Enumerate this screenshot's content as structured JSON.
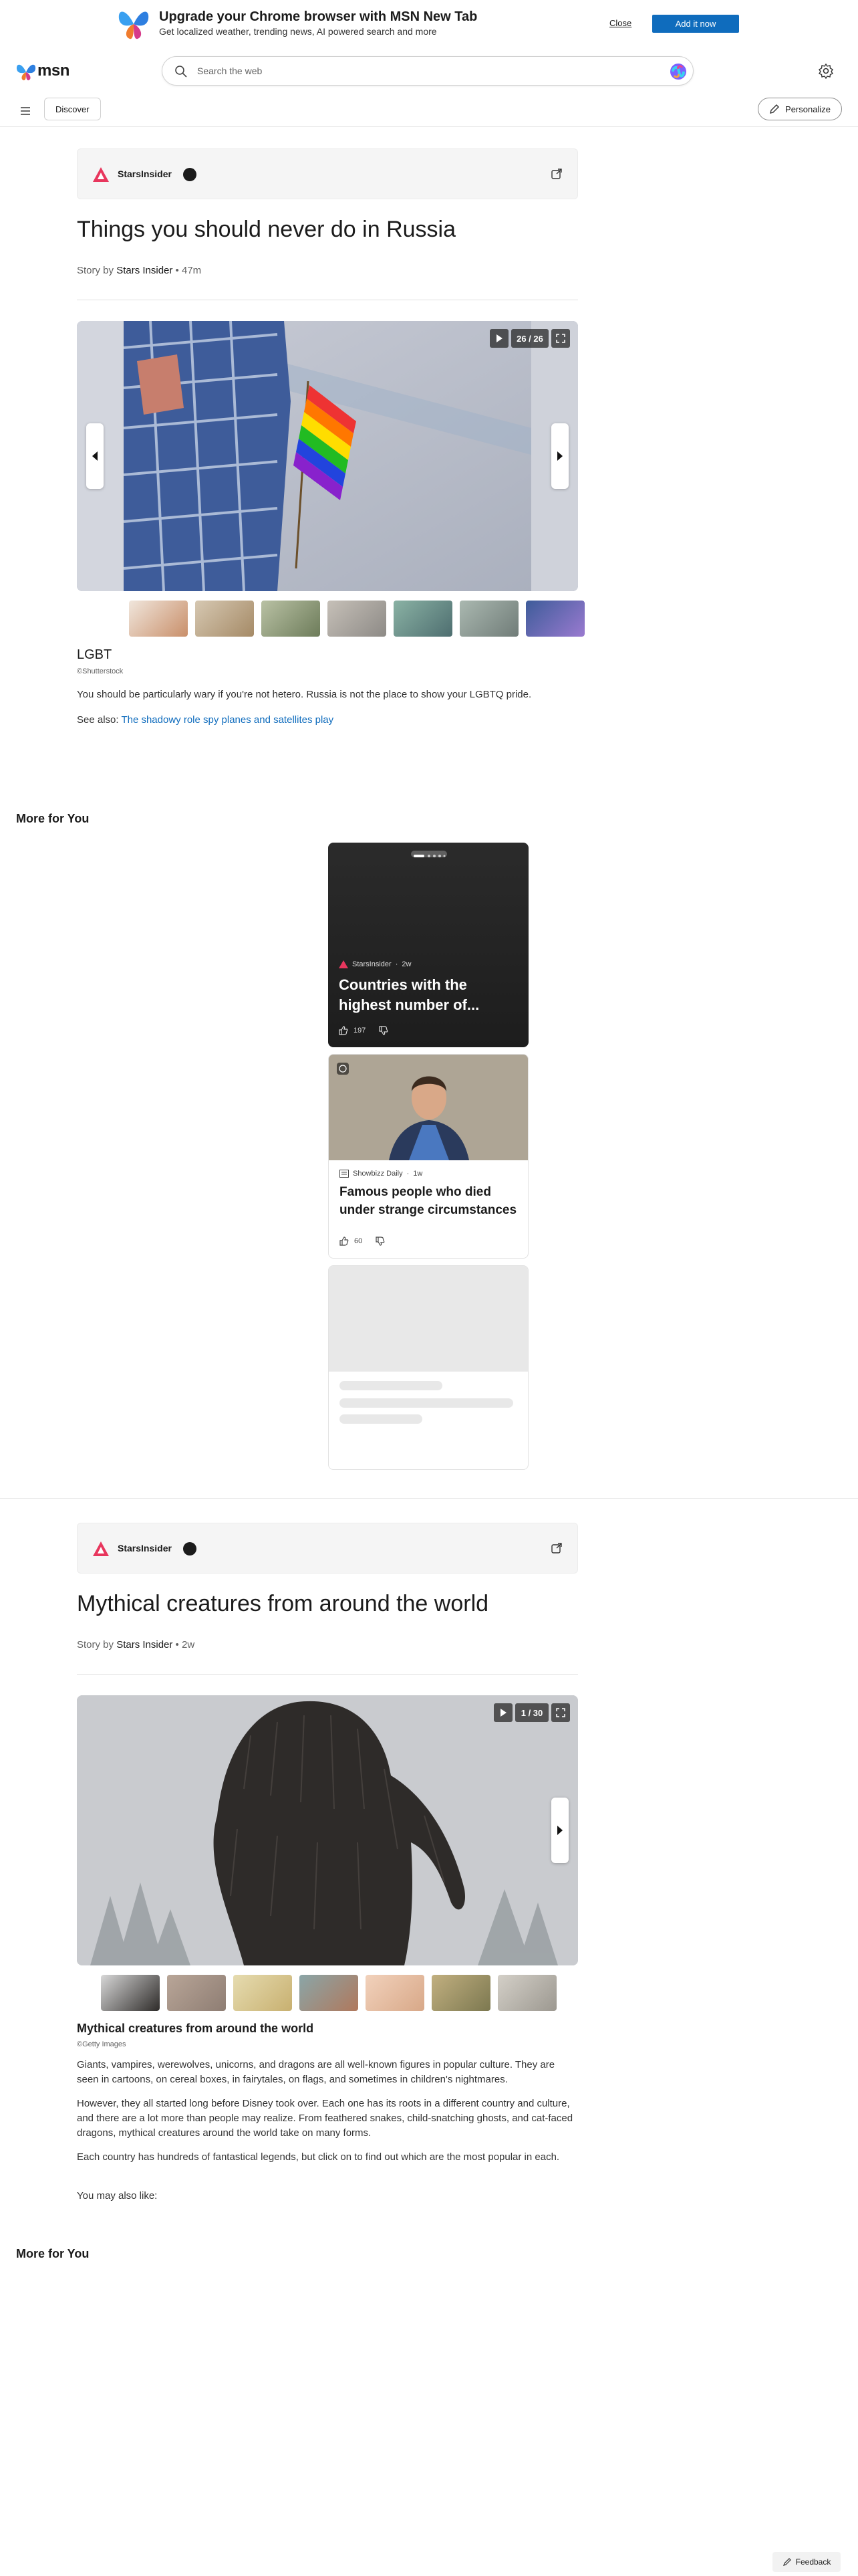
{
  "promo": {
    "title": "Upgrade your Chrome browser with MSN New Tab",
    "subtitle": "Get localized weather, trending news, AI powered search and more",
    "close_label": "Close",
    "add_label": "Add it now"
  },
  "header": {
    "brand": "msn",
    "search_placeholder": "Search the web"
  },
  "subnav": {
    "discover_label": "Discover",
    "personalize_label": "Personalize"
  },
  "article1": {
    "publisher": "StarsInsider",
    "title": "Things you should never do in Russia",
    "byline_prefix": "Story by ",
    "byline_author": "Stars Insider",
    "byline_time": " • 47m",
    "slide_counter": "26 / 26",
    "caption_title": "LGBT",
    "caption_credit": "©Shutterstock",
    "body": "You should be particularly wary if you're not hetero. Russia is not the place to show your LGBTQ pride.",
    "see_also_prefix": "See also: ",
    "see_also_link": "The shadowy role spy planes and satellites play"
  },
  "more_for_you_1": "More for You",
  "cards": {
    "card1": {
      "source": "StarsInsider",
      "age": "2w",
      "title": "Countries with the highest number of...",
      "likes": "197"
    },
    "card2": {
      "source": "Showbizz Daily",
      "age": "1w",
      "title": "Famous people who died under strange circumstances",
      "likes": "60"
    }
  },
  "article2": {
    "publisher": "StarsInsider",
    "title": "Mythical creatures from around the world",
    "byline_prefix": "Story by ",
    "byline_author": "Stars Insider",
    "byline_time": " • 2w",
    "slide_counter": "1 / 30",
    "caption_title": "Mythical creatures from around the world",
    "caption_credit": "©Getty Images",
    "p1": "Giants, vampires, werewolves, unicorns, and dragons are all well-known figures in popular culture. They are seen in cartoons, on cereal boxes, in fairytales, on flags, and sometimes in children's nightmares.",
    "p2": "However, they all started long before Disney took over. Each one has its roots in a different country and culture, and there are a lot more than people may realize. From feathered snakes, child-snatching ghosts, and cat-faced dragons, mythical creatures around the world take on many forms.",
    "p3": "Each country has hundreds of fantastical legends, but click on to find out which are the most popular in each.",
    "p4": "You may also like:"
  },
  "more_for_you_2": "More for You",
  "feedback_label": "Feedback",
  "colors": {
    "accent": "#0f6cbd",
    "publisher_logo": "#e8365d"
  }
}
